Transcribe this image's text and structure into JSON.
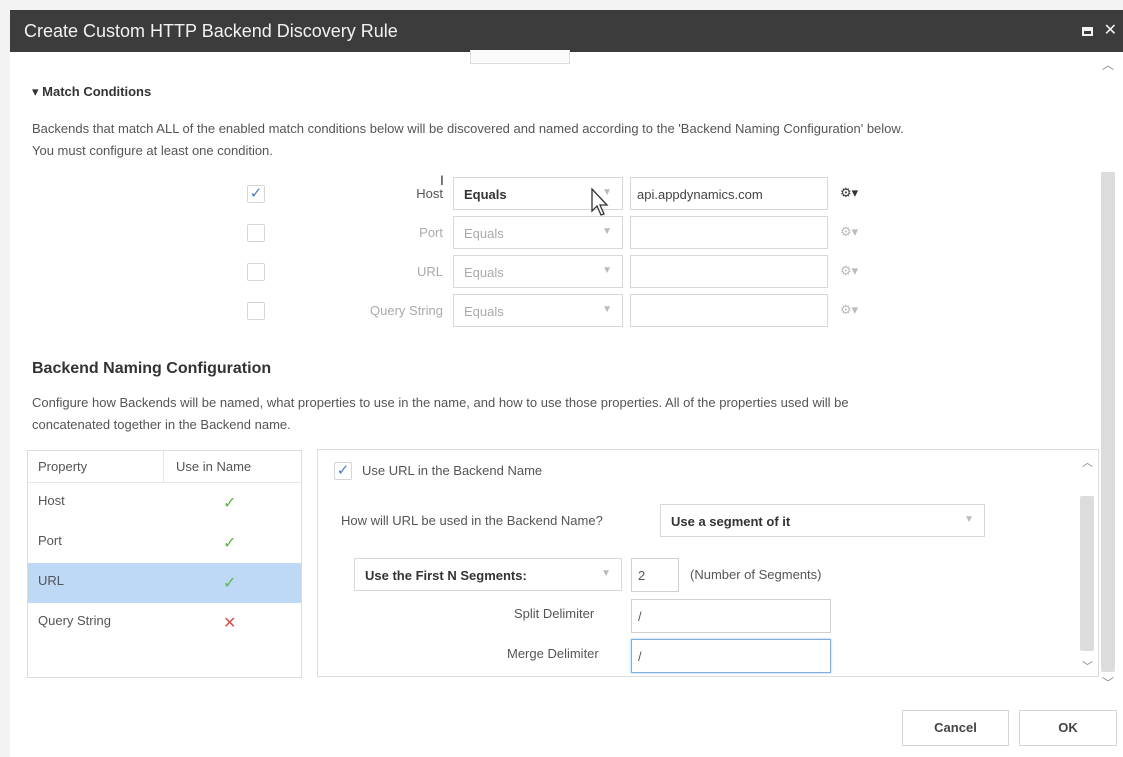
{
  "window": {
    "title": "Create Custom HTTP Backend Discovery Rule"
  },
  "match": {
    "section_label": "Match Conditions",
    "description_line1": "Backends that match ALL of the enabled match conditions below will be discovered and named according to the 'Backend Naming Configuration' below.",
    "description_line2": "You must configure at least one condition.",
    "conditions": [
      {
        "label": "Host",
        "checked": true,
        "operator": "Equals",
        "value": "api.appdynamics.com"
      },
      {
        "label": "Port",
        "checked": false,
        "operator": "Equals",
        "value": ""
      },
      {
        "label": "URL",
        "checked": false,
        "operator": "Equals",
        "value": ""
      },
      {
        "label": "Query String",
        "checked": false,
        "operator": "Equals",
        "value": ""
      }
    ]
  },
  "naming": {
    "heading": "Backend Naming Configuration",
    "description_line1": "Configure how Backends will be named, what properties to use in the name, and how to use those properties.  All of the properties used will be",
    "description_line2": "concatenated together in the Backend name.",
    "table_headers": {
      "property": "Property",
      "use_in_name": "Use in Name"
    },
    "properties": [
      {
        "name": "Host",
        "used": true,
        "selected": false
      },
      {
        "name": "Port",
        "used": true,
        "selected": false
      },
      {
        "name": "URL",
        "used": true,
        "selected": true
      },
      {
        "name": "Query String",
        "used": false,
        "selected": false
      }
    ],
    "detail": {
      "use_url_label": "Use URL in the Backend Name",
      "how_used_label": "How will URL be used in the Backend Name?",
      "how_used_value": "Use a segment of it",
      "segment_mode_value": "Use the First N Segments:",
      "segment_count": "2",
      "segment_count_hint": "(Number of Segments)",
      "split_delimiter_label": "Split Delimiter",
      "split_delimiter_value": "/",
      "merge_delimiter_label": "Merge Delimiter",
      "merge_delimiter_value": "/"
    }
  },
  "footer": {
    "cancel_label": "Cancel",
    "ok_label": "OK"
  },
  "colors": {
    "titlebar": "#3c3c3c",
    "selected_row": "#bdd9f6",
    "check_yes": "#5cb94a",
    "check_no": "#d9534f",
    "checkbox_tick": "#4a7fc9"
  }
}
